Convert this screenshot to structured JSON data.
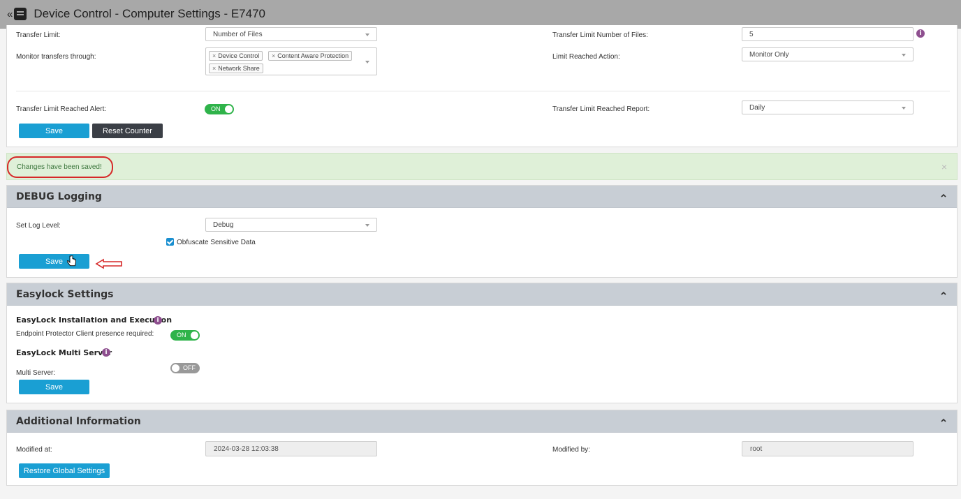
{
  "window": {
    "collapse_glyph": "«",
    "title": "Device Control - Computer Settings - E7470"
  },
  "transfer": {
    "transfer_limit_label": "Transfer Limit:",
    "transfer_limit_value": "Number of Files",
    "monitor_label": "Monitor transfers through:",
    "monitor_tags": [
      "Device Control",
      "Content Aware Protection",
      "Network Share"
    ],
    "limit_files_label": "Transfer Limit Number of Files:",
    "limit_files_value": "5",
    "limit_action_label": "Limit Reached Action:",
    "limit_action_value": "Monitor Only",
    "alert_label": "Transfer Limit Reached Alert:",
    "alert_toggle": "ON",
    "report_label": "Transfer Limit Reached Report:",
    "report_value": "Daily",
    "save_label": "Save",
    "reset_label": "Reset Counter"
  },
  "alert": {
    "message": "Changes have been saved!",
    "close_glyph": "×"
  },
  "debug": {
    "header": "DEBUG Logging",
    "log_level_label": "Set Log Level:",
    "log_level_value": "Debug",
    "obfuscate_label": "Obfuscate Sensitive Data",
    "obfuscate_checked": true,
    "save_label": "Save"
  },
  "easylock": {
    "header": "Easylock Settings",
    "install_heading": "EasyLock Installation and Execution",
    "presence_label": "Endpoint Protector Client presence required:",
    "presence_toggle": "ON",
    "multi_heading": "EasyLock Multi Server",
    "multi_label": "Multi Server:",
    "multi_toggle": "OFF",
    "save_label": "Save"
  },
  "additional": {
    "header": "Additional Information",
    "modified_at_label": "Modified at:",
    "modified_at_value": "2024-03-28 12:03:38",
    "modified_by_label": "Modified by:",
    "modified_by_value": "root",
    "restore_label": "Restore Global Settings"
  },
  "colors": {
    "accent_blue": "#1a9fd3",
    "toggle_on": "#2fb34a",
    "header_bg": "#c8ced5",
    "success_bg": "#dff0d8",
    "annotation_red": "#d62828"
  }
}
